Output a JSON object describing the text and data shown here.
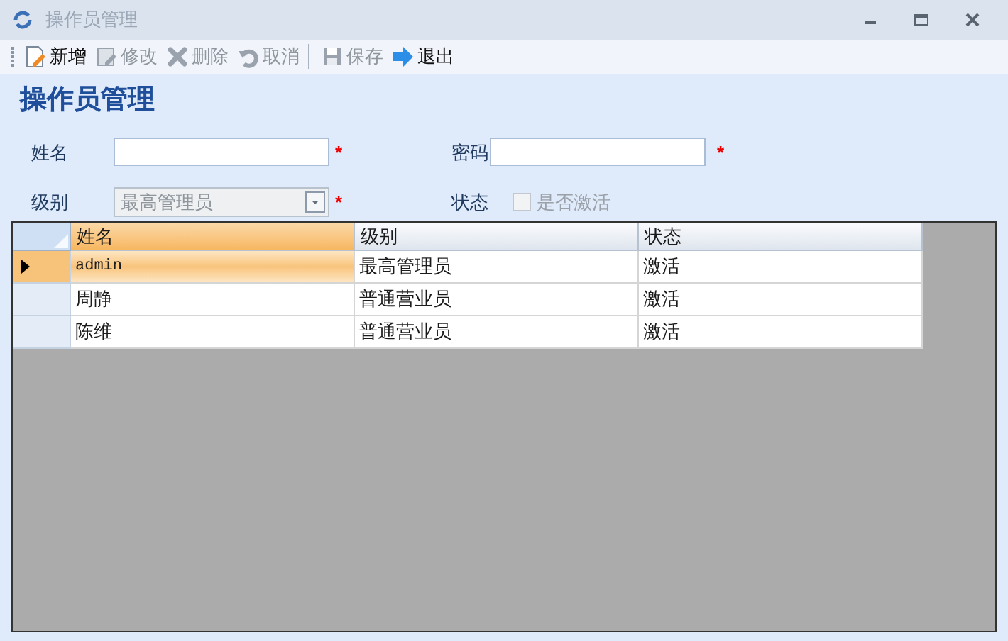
{
  "window": {
    "title": "操作员管理"
  },
  "toolbar": [
    {
      "kind": "new",
      "label": "新增",
      "disabled": false
    },
    {
      "kind": "edit",
      "label": "修改",
      "disabled": true
    },
    {
      "kind": "delete",
      "label": "删除",
      "disabled": true
    },
    {
      "kind": "cancel",
      "label": "取消",
      "disabled": true
    },
    {
      "kind": "save",
      "label": "保存",
      "disabled": true
    },
    {
      "kind": "exit",
      "label": "退出",
      "disabled": false
    }
  ],
  "heading": "操作员管理",
  "form": {
    "name": {
      "label": "姓名",
      "required_mark": "*"
    },
    "password": {
      "label": "密码",
      "required_mark": "*"
    },
    "level": {
      "label": "级别",
      "value": "最高管理员",
      "disabled": true,
      "required_mark": "*"
    },
    "status": {
      "label": "状态",
      "checkbox_label": "是否激活",
      "checked": false,
      "disabled": true
    }
  },
  "table": {
    "columns": [
      {
        "label": "姓名",
        "selected": true
      },
      {
        "label": "级别",
        "selected": false
      },
      {
        "label": "状态",
        "selected": false
      }
    ],
    "rows": [
      {
        "cells": [
          "admin",
          "最高管理员",
          "激活"
        ],
        "selected": true
      },
      {
        "cells": [
          "周静",
          "普通营业员",
          "激活"
        ],
        "selected": false
      },
      {
        "cells": [
          "陈维",
          "普通营业员",
          "激活"
        ],
        "selected": false
      }
    ]
  }
}
